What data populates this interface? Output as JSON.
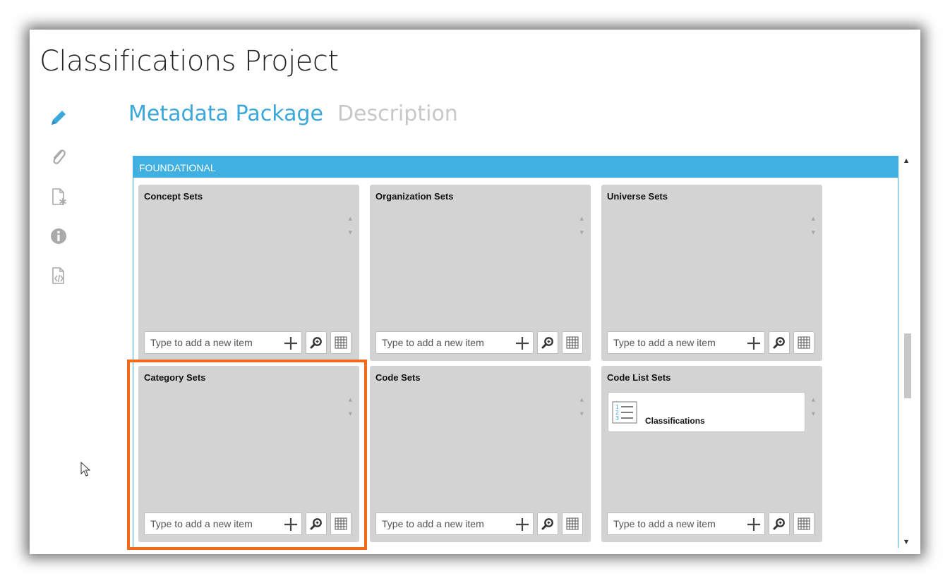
{
  "app": {
    "title": "Classifications Project"
  },
  "sidebar": {
    "icons": [
      "pencil-icon",
      "paperclip-icon",
      "document-asterisk-icon",
      "info-icon",
      "document-code-icon"
    ]
  },
  "tabs": [
    {
      "label": "Metadata Package",
      "active": true
    },
    {
      "label": "Description",
      "active": false
    }
  ],
  "section": {
    "title": "FOUNDATIONAL"
  },
  "panels": [
    {
      "title": "Concept Sets",
      "placeholder": "Type to add a new item",
      "items": []
    },
    {
      "title": "Organization Sets",
      "placeholder": "Type to add a new item",
      "items": []
    },
    {
      "title": "Universe Sets",
      "placeholder": "Type to add a new item",
      "items": []
    },
    {
      "title": "Category Sets",
      "placeholder": "Type to add a new item",
      "items": [],
      "highlighted": true
    },
    {
      "title": "Code Sets",
      "placeholder": "Type to add a new item",
      "items": []
    },
    {
      "title": "Code List Sets",
      "placeholder": "Type to add a new item",
      "items": [
        {
          "label": "Classifications",
          "icon": "numbered-list-icon"
        }
      ]
    }
  ],
  "colors": {
    "accent": "#3aa8dc",
    "section_header": "#40b0e2",
    "panel_bg": "#d3d3d3",
    "highlight": "#f26b1d",
    "inactive_tab": "#c8c8c8"
  }
}
